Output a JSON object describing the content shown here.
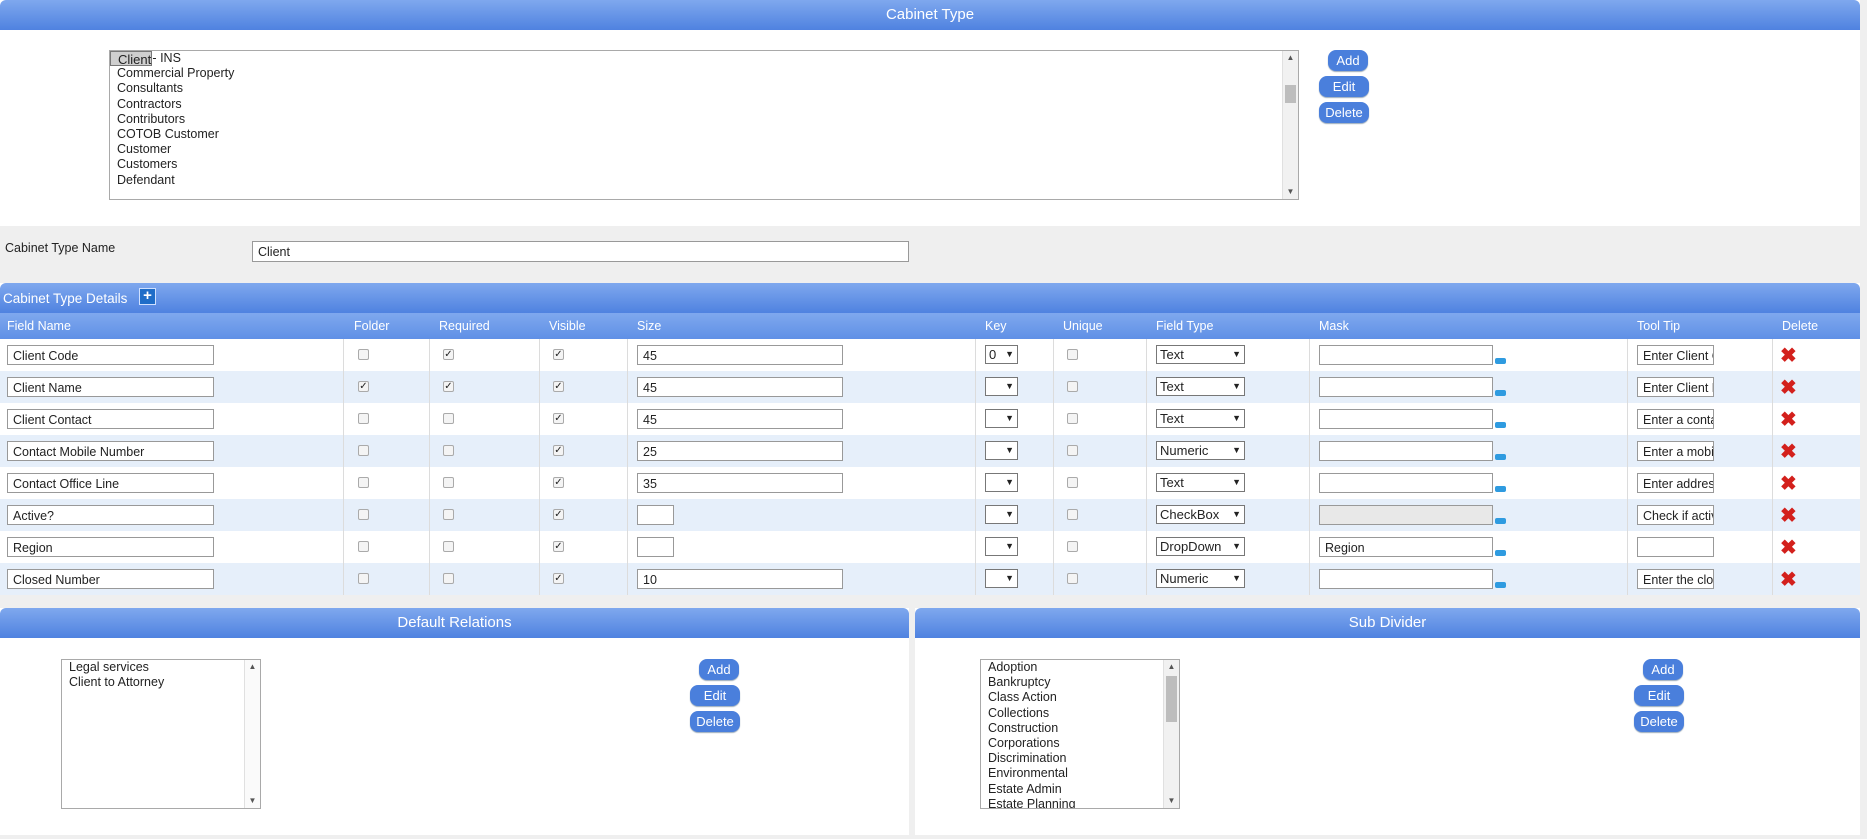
{
  "cabinet_type": {
    "title": "Cabinet Type",
    "list": [
      "Client",
      "Client - INS",
      "Commercial Property",
      "Consultants",
      "Contractors",
      "Contributors",
      "COTOB Customer",
      "Customer",
      "Customers",
      "Defendant"
    ],
    "add": "Add",
    "edit": "Edit",
    "delete": "Delete"
  },
  "name_field": {
    "label": "Cabinet Type Name",
    "value": "Client"
  },
  "details": {
    "title": "Cabinet Type Details",
    "columns": [
      "Field Name",
      "Folder",
      "Required",
      "Visible",
      "Size",
      "Key",
      "Unique",
      "Field Type",
      "Mask",
      "Tool Tip",
      "Delete"
    ],
    "rows": [
      {
        "name": "Client Code",
        "folder": false,
        "required": true,
        "visible": true,
        "size": "45",
        "key": "0",
        "unique": false,
        "type": "Text",
        "mask": "",
        "tip": "Enter Client C"
      },
      {
        "name": "Client Name",
        "folder": true,
        "required": true,
        "visible": true,
        "size": "45",
        "key": "",
        "unique": false,
        "type": "Text",
        "mask": "",
        "tip": "Enter Client N"
      },
      {
        "name": "Client Contact",
        "folder": false,
        "required": false,
        "visible": true,
        "size": "45",
        "key": "",
        "unique": false,
        "type": "Text",
        "mask": "",
        "tip": "Enter a conta"
      },
      {
        "name": "Contact Mobile Number",
        "folder": false,
        "required": false,
        "visible": true,
        "size": "25",
        "key": "",
        "unique": false,
        "type": "Numeric",
        "mask": "",
        "tip": "Enter a mobi"
      },
      {
        "name": "Contact Office Line",
        "folder": false,
        "required": false,
        "visible": true,
        "size": "35",
        "key": "",
        "unique": false,
        "type": "Text",
        "mask": "",
        "tip": "Enter addres"
      },
      {
        "name": "Active?",
        "folder": false,
        "required": false,
        "visible": true,
        "size": "",
        "key": "",
        "unique": false,
        "type": "CheckBox",
        "mask": "",
        "tip": "Check if activ"
      },
      {
        "name": "Region",
        "folder": false,
        "required": false,
        "visible": true,
        "size": "",
        "key": "",
        "unique": false,
        "type": "DropDown",
        "mask": "Region",
        "tip": ""
      },
      {
        "name": "Closed Number",
        "folder": false,
        "required": false,
        "visible": true,
        "size": "10",
        "key": "",
        "unique": false,
        "type": "Numeric",
        "mask": "",
        "tip": "Enter the clos"
      }
    ]
  },
  "default_relations": {
    "title": "Default Relations",
    "list": [
      "Legal services",
      "Client to Attorney"
    ],
    "add": "Add",
    "edit": "Edit",
    "delete": "Delete"
  },
  "sub_divider": {
    "title": "Sub Divider",
    "list": [
      "Adoption",
      "Bankruptcy",
      "Class Action",
      "Collections",
      "Construction",
      "Corporations",
      "Discrimination",
      "Environmental",
      "Estate Admin",
      "Estate Planning"
    ],
    "add": "Add",
    "edit": "Edit",
    "delete": "Delete"
  }
}
